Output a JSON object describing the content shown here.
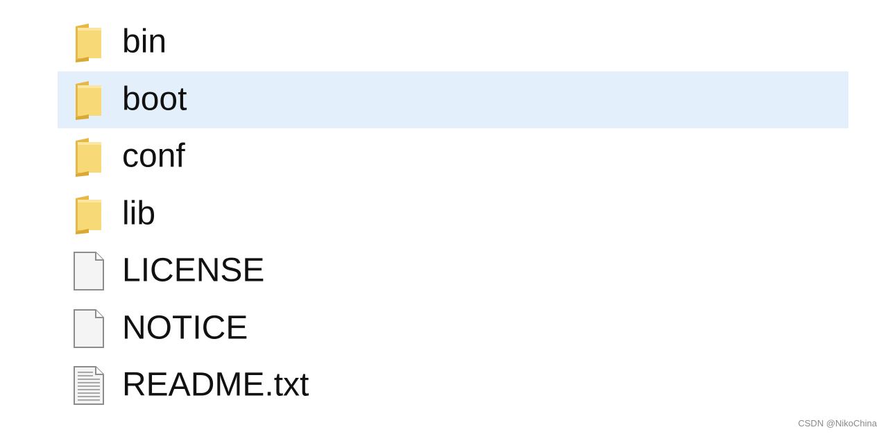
{
  "files": [
    {
      "name": "bin",
      "type": "folder",
      "icon": "folder-icon",
      "selected": false
    },
    {
      "name": "boot",
      "type": "folder",
      "icon": "folder-icon",
      "selected": true
    },
    {
      "name": "conf",
      "type": "folder",
      "icon": "folder-icon",
      "selected": false
    },
    {
      "name": "lib",
      "type": "folder",
      "icon": "folder-icon",
      "selected": false
    },
    {
      "name": "LICENSE",
      "type": "file",
      "icon": "blank-file-icon",
      "selected": false
    },
    {
      "name": "NOTICE",
      "type": "file",
      "icon": "blank-file-icon",
      "selected": false
    },
    {
      "name": "README.txt",
      "type": "text-file",
      "icon": "text-file-icon",
      "selected": false
    }
  ],
  "watermark": "CSDN @NikoChina",
  "colors": {
    "selection": "#e3f0fc",
    "folder_front": "#f7d777",
    "folder_back": "#e9bf4c",
    "text": "#111111"
  }
}
